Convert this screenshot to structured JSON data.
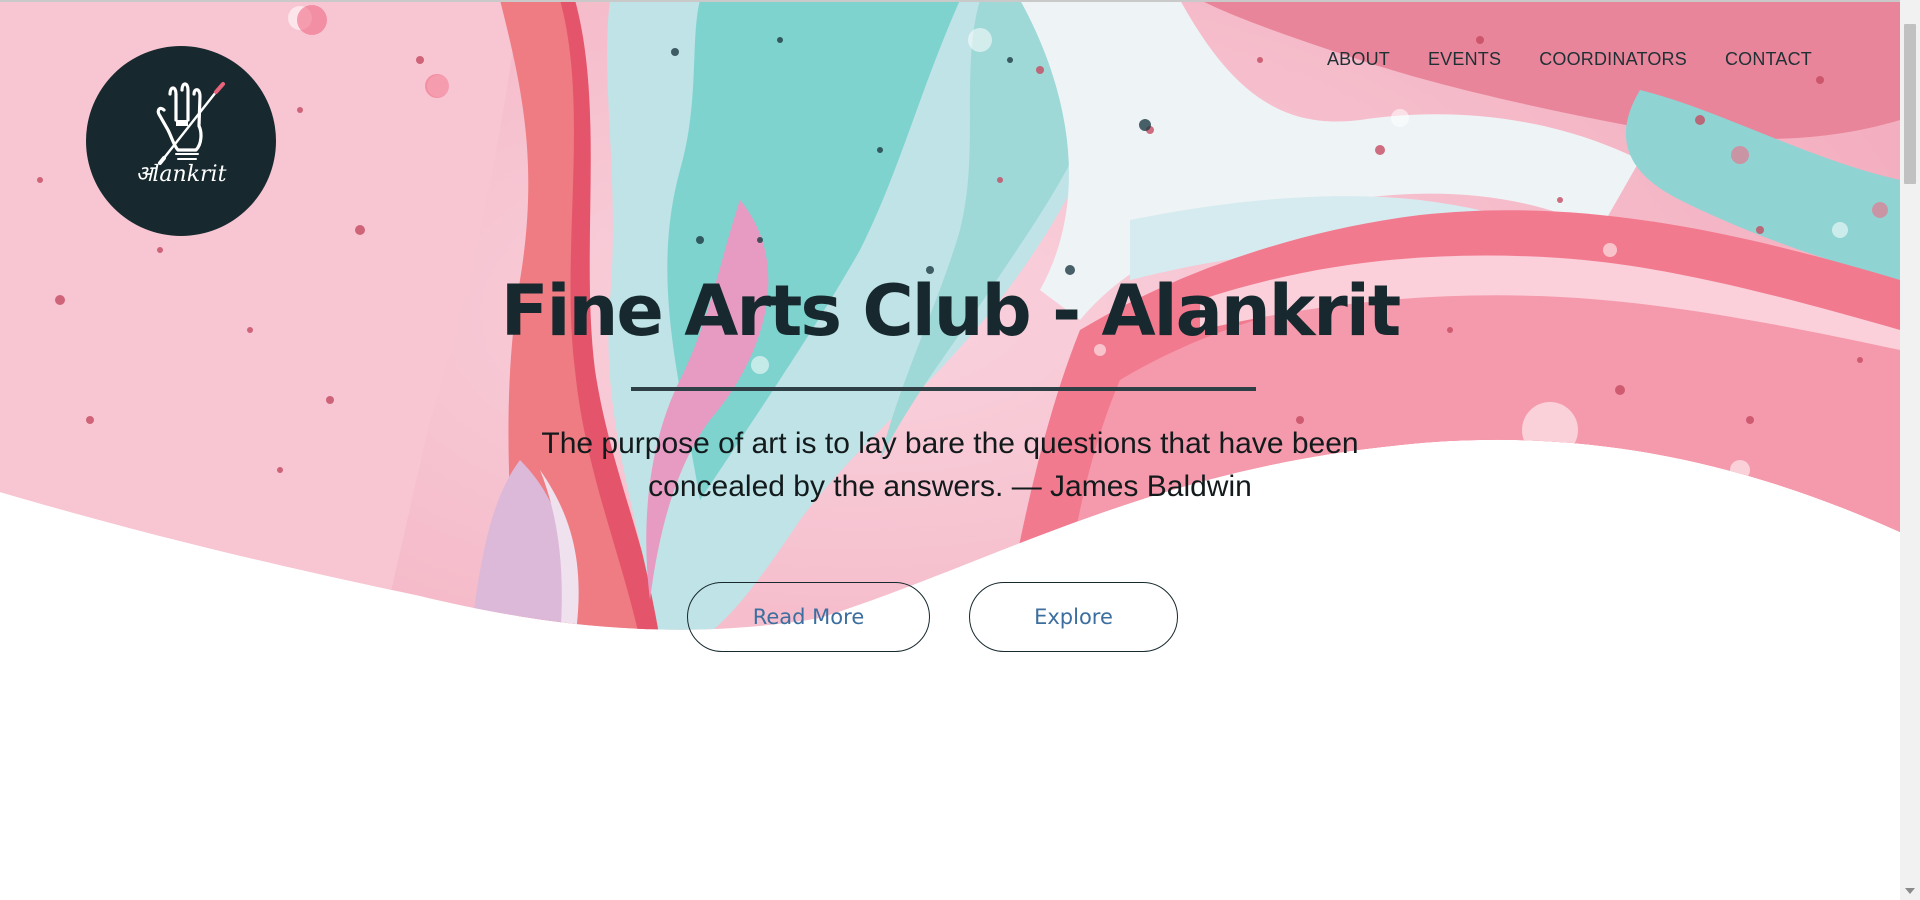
{
  "app": {
    "logo_icon": "hand-with-brush-logo",
    "logo_text": "अlankrit"
  },
  "nav": {
    "items": [
      {
        "label": "ABOUT"
      },
      {
        "label": "EVENTS"
      },
      {
        "label": "COORDINATORS"
      },
      {
        "label": "CONTACT"
      }
    ]
  },
  "hero": {
    "title": "Fine Arts Club - Alankrit",
    "quote_line1": "The purpose of art is to lay bare the questions that have been",
    "quote_line2": "concealed by the answers. — James Baldwin",
    "buttons": {
      "read_more": "Read More",
      "explore": "Explore"
    }
  },
  "colors": {
    "accent_dark": "#17292e",
    "button_text": "#3c6f9f",
    "background_pink": "#f4a9bb",
    "background_teal": "#6ecfcc",
    "background_coral": "#ee6e7e"
  }
}
